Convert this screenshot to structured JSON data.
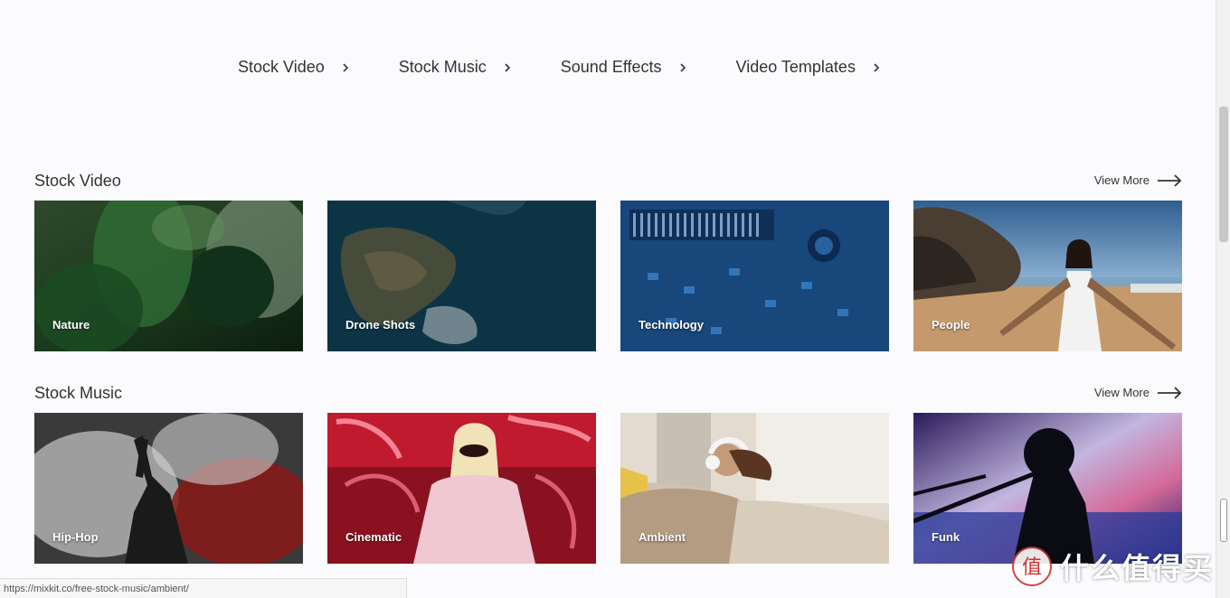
{
  "nav": {
    "items": [
      {
        "label": "Stock Video"
      },
      {
        "label": "Stock Music"
      },
      {
        "label": "Sound Effects"
      },
      {
        "label": "Video Templates"
      }
    ]
  },
  "sections": [
    {
      "title": "Stock Video",
      "view_more": "View More",
      "cards": [
        {
          "label": "Nature"
        },
        {
          "label": "Drone Shots"
        },
        {
          "label": "Technology"
        },
        {
          "label": "People"
        }
      ]
    },
    {
      "title": "Stock Music",
      "view_more": "View More",
      "cards": [
        {
          "label": "Hip-Hop"
        },
        {
          "label": "Cinematic"
        },
        {
          "label": "Ambient"
        },
        {
          "label": "Funk"
        }
      ]
    }
  ],
  "status_url": "https://mixkit.co/free-stock-music/ambient/",
  "watermark_text": "什么值得买",
  "watermark_logo_glyph": "值"
}
